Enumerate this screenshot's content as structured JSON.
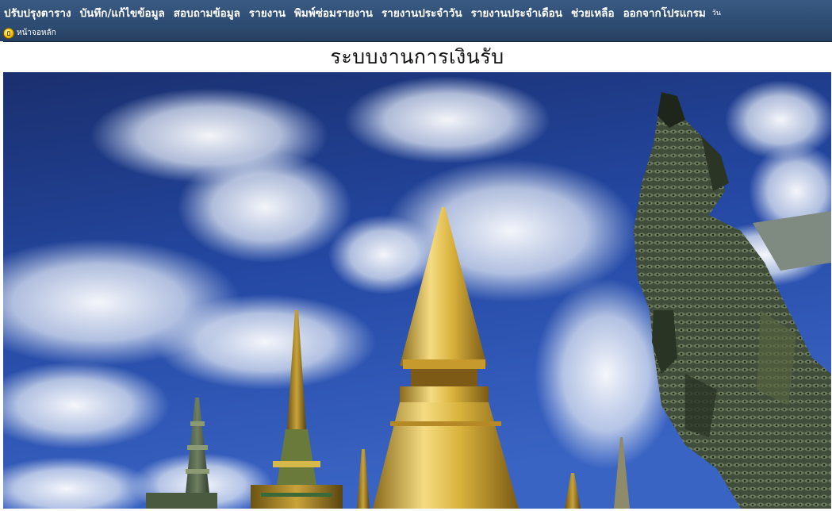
{
  "menu": {
    "items": [
      "ปรับปรุงตาราง",
      "บันทึก/แก้ไขข้อมูล",
      "สอบถามข้อมูล",
      "รายงาน",
      "พิมพ์ซ่อมรายงาน",
      "รายงานประจำวัน",
      "รายงานประจำเดือน",
      "ช่วยเหลือ",
      "ออกจากโปรแกรม"
    ],
    "overflow": "วัน"
  },
  "toolbar": {
    "home_label": "หน้าจอหลัก",
    "home_icon": "home-icon"
  },
  "page": {
    "title": "ระบบงานการเงินรับ"
  },
  "colors": {
    "menubar": "#2c4a70",
    "sky": "#1e3b8a",
    "gold": "#d9b23c"
  }
}
